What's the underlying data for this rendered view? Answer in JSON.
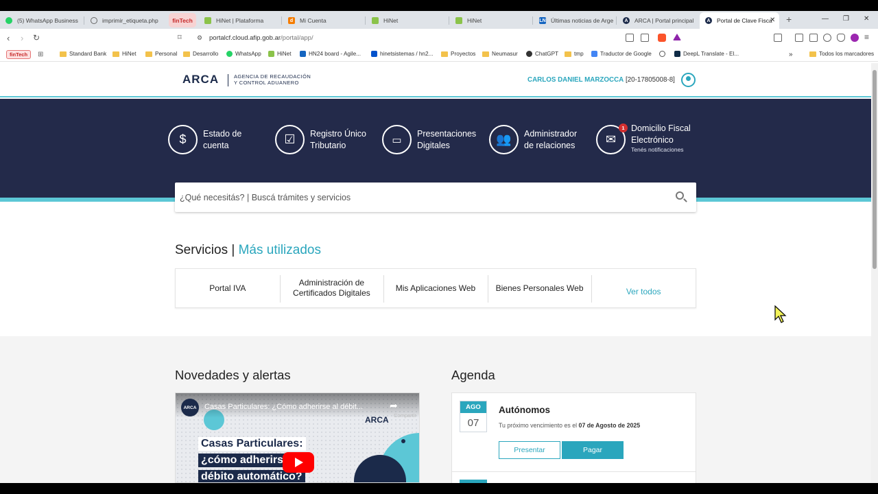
{
  "browser": {
    "tabs": [
      {
        "label": "(5) WhatsApp Business",
        "icon": "whatsapp-icon"
      },
      {
        "label": "imprimir_etiqueta.php",
        "icon": "globe-icon"
      },
      {
        "label": "finTech",
        "icon": "fintech-group"
      },
      {
        "label": "HiNet | Plataforma",
        "icon": "hinet-icon"
      },
      {
        "label": "Mi Cuenta",
        "icon": "doc-icon"
      },
      {
        "label": "HiNet",
        "icon": "hinet-icon"
      },
      {
        "label": "HiNet",
        "icon": "hinet-icon"
      },
      {
        "label": "Últimas noticias de Arge",
        "icon": "news-icon"
      },
      {
        "label": "ARCA | Portal principal",
        "icon": "arca-icon"
      },
      {
        "label": "Portal de Clave Fisca",
        "icon": "arca-icon",
        "active": true
      }
    ],
    "url_host": "portalcf.cloud.afip.gob.ar",
    "url_path": "/portal/app/",
    "bookmarks": [
      {
        "label": "finTech",
        "type": "group"
      },
      {
        "label": "Standard Bank",
        "type": "folder"
      },
      {
        "label": "HiNet",
        "type": "folder"
      },
      {
        "label": "Personal",
        "type": "folder"
      },
      {
        "label": "Desarrollo",
        "type": "folder"
      },
      {
        "label": "WhatsApp",
        "type": "link"
      },
      {
        "label": "HiNet",
        "type": "link"
      },
      {
        "label": "HN24 board - Agile...",
        "type": "link"
      },
      {
        "label": "hinetsistemas / hn2...",
        "type": "link"
      },
      {
        "label": "Proyectos",
        "type": "folder"
      },
      {
        "label": "Neumasur",
        "type": "folder"
      },
      {
        "label": "ChatGPT",
        "type": "link"
      },
      {
        "label": "tmp",
        "type": "folder"
      },
      {
        "label": "Traductor de Google",
        "type": "link"
      },
      {
        "label": "DeepL Translate - El...",
        "type": "link"
      },
      {
        "label": "Todos los marcadores",
        "type": "folder"
      }
    ],
    "more_bookmarks": "»"
  },
  "header": {
    "logo": "ARCA",
    "logo_sub_1": "AGENCIA DE RECAUDACIÓN",
    "logo_sub_2": "Y CONTROL ADUANERO",
    "user_name": "CARLOS DANIEL MARZOCCA",
    "user_cuit": "[20-17805008-8]"
  },
  "quick_links": [
    {
      "line1": "Estado de",
      "line2": "cuenta",
      "icon": "dollar-icon"
    },
    {
      "line1": "Registro Único",
      "line2": "Tributario",
      "icon": "checkbox-icon"
    },
    {
      "line1": "Presentaciones",
      "line2": "Digitales",
      "icon": "laptop-icon"
    },
    {
      "line1": "Administrador",
      "line2": "de relaciones",
      "icon": "users-icon"
    },
    {
      "line1": "Domicilio Fiscal",
      "line2": "Electrónico",
      "sub": "Tenés notificaciones",
      "icon": "envelope-icon",
      "badge": "1"
    }
  ],
  "search": {
    "placeholder": "¿Qué necesitás? | Buscá trámites y servicios"
  },
  "services": {
    "title": "Servicios |",
    "title_highlight": "Más utilizados",
    "items": [
      "Portal IVA",
      "Administración de Certificados Digitales",
      "Mis Aplicaciones Web",
      "Bienes Personales Web"
    ],
    "ver_todos": "Ver todos"
  },
  "news": {
    "title": "Novedades y alertas",
    "video_channel": "ARCA",
    "video_title": "Casas Particulares: ¿Cómo adherirse al débit...",
    "video_share": "Compartir",
    "video_brand": "ARCA",
    "video_line1": "Casas Particulares:",
    "video_line2": "¿cómo adherirse al",
    "video_line3": "débito automático?"
  },
  "agenda": {
    "title": "Agenda",
    "items": [
      {
        "month": "AGO",
        "day": "07",
        "name": "Autónomos",
        "text": "Tu próximo vencimiento es el",
        "date_text": "07 de Agosto de 2025",
        "btn_presentar": "Presentar",
        "btn_pagar": "Pagar"
      }
    ]
  },
  "colors": {
    "navy": "#232a4a",
    "accent": "#2aa6bd",
    "cyan": "#5cc7d6"
  }
}
